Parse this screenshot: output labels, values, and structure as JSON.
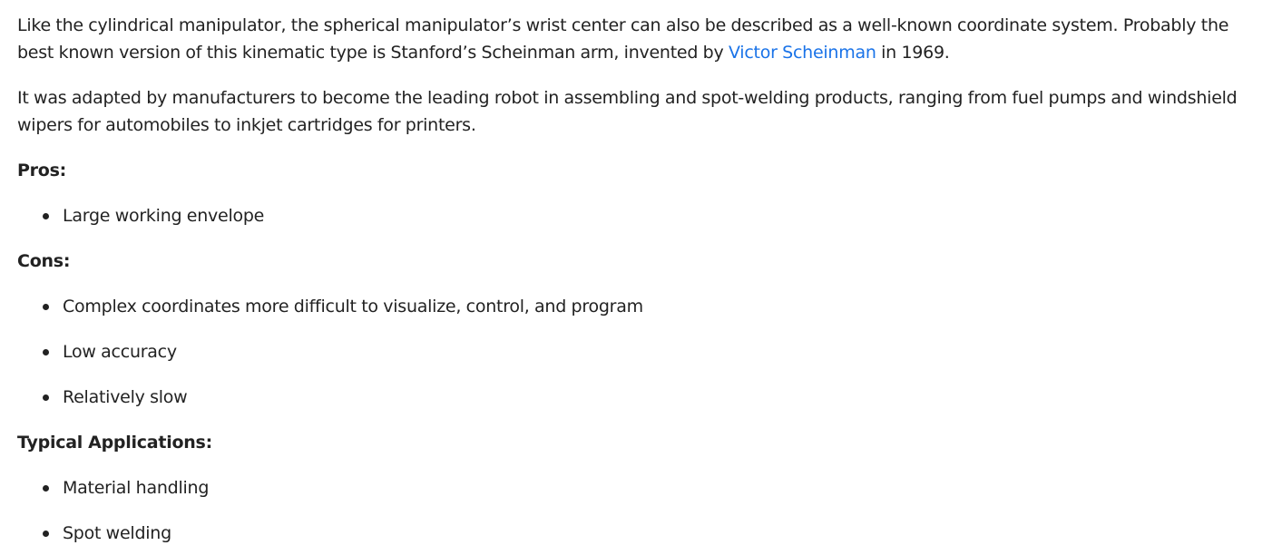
{
  "article": {
    "para1": {
      "text_before_link": "Like the cylindrical manipulator, the spherical manipulator’s wrist center can also be described as a well-known coordinate system. Probably the best known version of this kinematic type is Stanford’s Scheinman arm, invented by ",
      "link_text": "Victor Scheinman",
      "text_after_link": " in 1969.",
      "link_color": "#1a73e8"
    },
    "para2": "It was adapted by manufacturers to become the leading robot in assembling and spot-welding products, ranging from fuel pumps and windshield wipers for automobiles to inkjet cartridges for printers.",
    "pros": {
      "heading": "Pros:",
      "items": [
        "Large working envelope"
      ]
    },
    "cons": {
      "heading": "Cons:",
      "items": [
        "Complex coordinates more difficult to visualize, control, and program",
        "Low accuracy",
        "Relatively slow"
      ]
    },
    "applications": {
      "heading": "Typical Applications:",
      "items": [
        "Material handling",
        "Spot welding"
      ]
    }
  }
}
